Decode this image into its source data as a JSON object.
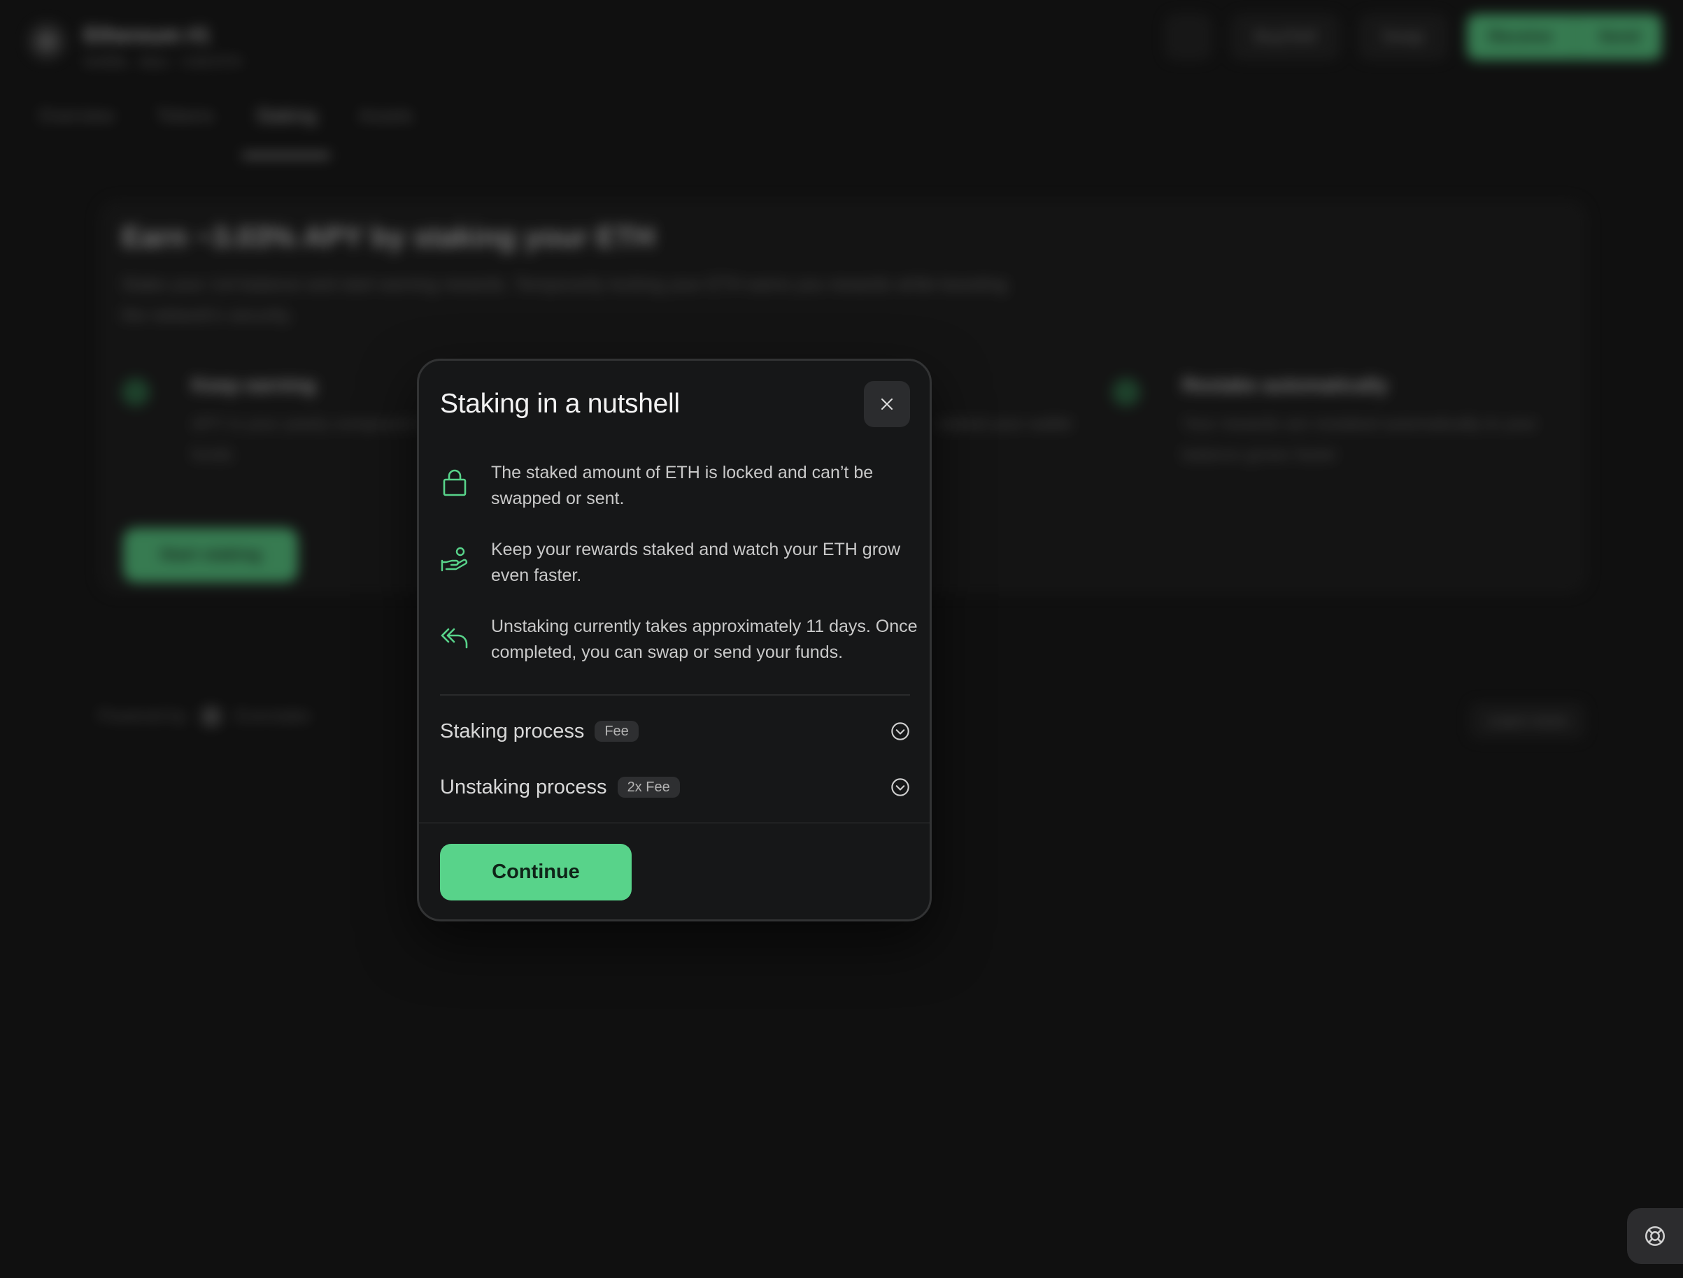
{
  "background": {
    "account": {
      "name": "Ethereum #1",
      "subtitle": "0x4f2b…9a1c · 0.00 ETH"
    },
    "header_actions": {
      "deposit": "Buy/Sell",
      "swap": "Swap",
      "receive": "Receive",
      "send": "Send"
    },
    "tabs": [
      {
        "label": "Overview"
      },
      {
        "label": "Tokens"
      },
      {
        "label": "Staking"
      },
      {
        "label": "Assets"
      }
    ],
    "promo": {
      "title": "Earn ~3.03% APY by staking your ETH",
      "description": "Stake your 1rd balance and start earning rewards. Temporarily locking your ETH earns you rewards while boosting the network's security.",
      "features": [
        {
          "title": "Keep earning",
          "desc": "APY is your yearly compound rate on your staked funds"
        },
        {
          "title": "",
          "desc": "staked your wallet"
        },
        {
          "title": "Restake automatically",
          "desc": "Your rewards are restaked automatically to your balance grows faster"
        }
      ],
      "cta": "Start staking"
    },
    "powered_by": {
      "label": "Powered by",
      "provider": "Everstake"
    },
    "learn_more": "Learn more"
  },
  "modal": {
    "title": "Staking in a nutshell",
    "points": [
      {
        "icon": "lock-icon",
        "text": "The staked amount of ETH is locked and can’t be swapped or sent."
      },
      {
        "icon": "hand-coins-icon",
        "text": "Keep your rewards staked and watch your ETH grow even faster."
      },
      {
        "icon": "double-arrow-back-icon",
        "text": "Unstaking currently takes approximately 11 days. Once completed, you can swap or send your funds."
      }
    ],
    "accordions": [
      {
        "label": "Staking process",
        "badge": "Fee"
      },
      {
        "label": "Unstaking process",
        "badge": "2x Fee"
      }
    ],
    "continue_label": "Continue"
  },
  "colors": {
    "accent": "#58d38a",
    "modal_bg": "#161718",
    "page_bg": "#101010"
  }
}
